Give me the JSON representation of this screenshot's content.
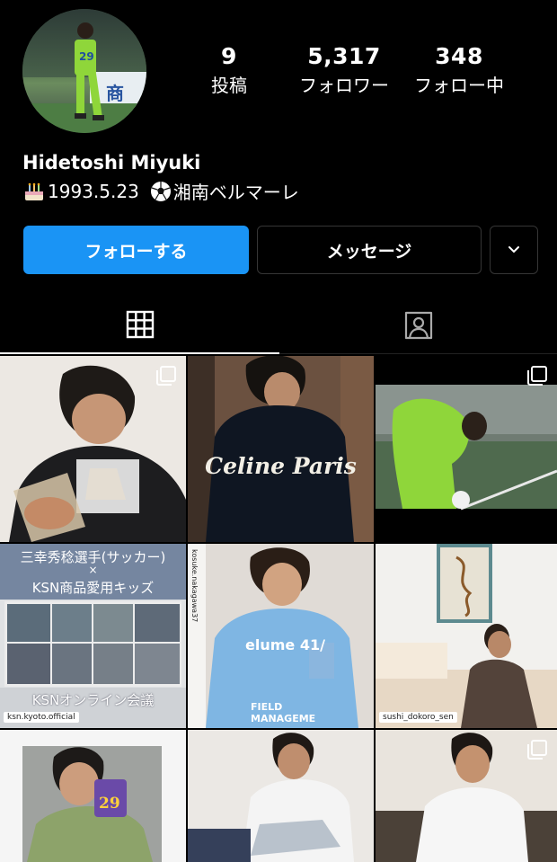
{
  "profile": {
    "name": "Hidetoshi Miyuki",
    "bio_birthday": "1993.5.23",
    "bio_club": "湘南ベルマーレ",
    "avatar_text": "商"
  },
  "stats": {
    "posts": {
      "value": "9",
      "label": "投稿"
    },
    "followers": {
      "value": "5,317",
      "label": "フォロワー"
    },
    "following": {
      "value": "348",
      "label": "フォロー中"
    }
  },
  "actions": {
    "follow": "フォローする",
    "message": "メッセージ"
  },
  "tabs": [
    "grid-icon",
    "tagged-icon"
  ],
  "posts": [
    {
      "title": "",
      "icon": "multi-photo-icon"
    },
    {
      "title": "Celine Paris"
    },
    {
      "title": "",
      "icon": "multi-photo-icon"
    },
    {
      "title": "三幸秀稔選手(サッカー)",
      "subtitle": "×",
      "subtitle2": "KSN商品愛用キッズ",
      "footer": "KSNオンライン会議",
      "tag": "ksn.kyoto.official"
    },
    {
      "title": "kosuke.nakagawa37",
      "shirt": "elume 41/",
      "shirt2": "FIELD MANAGEME"
    },
    {
      "title": "sushi_dokoro_sen"
    },
    {
      "title": "29"
    },
    {
      "title": ""
    },
    {
      "title": "",
      "icon": "multi-photo-icon"
    }
  ],
  "colors": {
    "follow_button": "#1a94f5",
    "background": "#000000",
    "border": "#363636"
  }
}
